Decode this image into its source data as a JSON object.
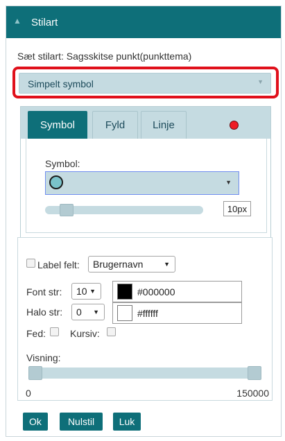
{
  "header": {
    "title": "Stilart"
  },
  "subtitle": "Sæt stilart: Sagsskitse punkt(punkttema)",
  "style_type": {
    "selected": "Simpelt symbol"
  },
  "tabs": [
    {
      "label": "Symbol",
      "active": true
    },
    {
      "label": "Fyld",
      "active": false
    },
    {
      "label": "Linje",
      "active": false
    }
  ],
  "indicator_color": "#ee1c24",
  "symbol": {
    "label": "Symbol:",
    "size_value": "10px",
    "size_slider_fraction": 0.1
  },
  "labels": {
    "label_field_text": "Label felt:",
    "label_field_checked": false,
    "label_field_value": "Brugernavn",
    "font_size_label": "Font str:",
    "font_size_value": "10",
    "font_color": "#000000",
    "halo_size_label": "Halo str:",
    "halo_size_value": "0",
    "halo_color": "#ffffff",
    "bold_label": "Fed:",
    "italic_label": "Kursiv:",
    "visibility_label": "Visning:",
    "visibility_min": "0",
    "visibility_max": "150000"
  },
  "buttons": {
    "ok": "Ok",
    "reset": "Nulstil",
    "close": "Luk"
  },
  "colors": {
    "accent": "#0e6f79",
    "panel_blue": "#c5dbe1",
    "highlight_red": "#e0101b"
  }
}
